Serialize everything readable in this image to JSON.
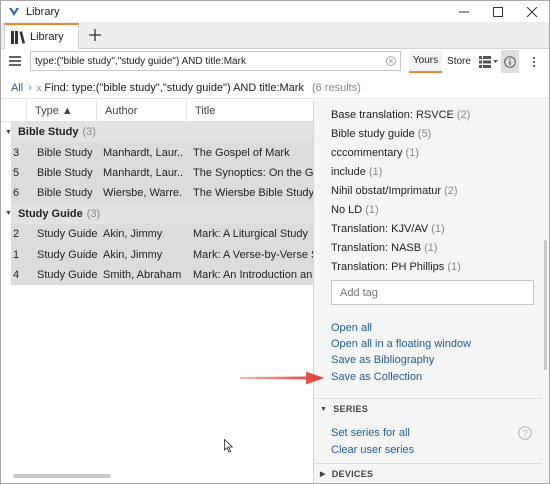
{
  "window": {
    "title": "Library"
  },
  "tab": {
    "label": "Library",
    "add_label": "+"
  },
  "search": {
    "value": "type:(\"bible study\",\"study guide\") AND title:Mark"
  },
  "toolbar": {
    "yours": "Yours",
    "store": "Store"
  },
  "breadcrumb": {
    "all": "All",
    "separator": "›",
    "close": "x",
    "find": "Find: type:(\"bible study\",\"study guide\") AND title:Mark",
    "count": "(6 results)"
  },
  "table": {
    "columns": {
      "type": "Type ▲",
      "author": "Author",
      "title": "Title"
    },
    "groups": [
      {
        "name": "Bible Study",
        "count": "(3)",
        "rows": [
          {
            "num": "3",
            "type": "Bible Study",
            "author": "Manhardt, Laur...",
            "title": "The Gospel of Mark"
          },
          {
            "num": "5",
            "type": "Bible Study",
            "author": "Manhardt, Laur...",
            "title": "The Synoptics: On the Go"
          },
          {
            "num": "6",
            "type": "Bible Study",
            "author": "Wiersbe, Warre...",
            "title": "The Wiersbe Bible Study"
          }
        ]
      },
      {
        "name": "Study Guide",
        "count": "(3)",
        "rows": [
          {
            "num": "2",
            "type": "Study Guide",
            "author": "Akin, Jimmy",
            "title": "Mark: A Liturgical Study"
          },
          {
            "num": "1",
            "type": "Study Guide",
            "author": "Akin, Jimmy",
            "title": "Mark: A Verse-by-Verse S"
          },
          {
            "num": "4",
            "type": "Study Guide",
            "author": "Smith, Abraham",
            "title": "Mark: An Introduction an"
          }
        ]
      }
    ]
  },
  "sidebar": {
    "tags": [
      {
        "label": "Base translation: RSVCE",
        "count": "(2)"
      },
      {
        "label": "Bible study guide",
        "count": "(5)"
      },
      {
        "label": "cccommentary",
        "count": "(1)"
      },
      {
        "label": "include",
        "count": "(1)"
      },
      {
        "label": "Nihil obstat/Imprimatur",
        "count": "(2)"
      },
      {
        "label": "No LD",
        "count": "(1)"
      },
      {
        "label": "Translation: KJV/AV",
        "count": "(1)"
      },
      {
        "label": "Translation: NASB",
        "count": "(1)"
      },
      {
        "label": "Translation: PH Phillips",
        "count": "(1)"
      }
    ],
    "add_tag_placeholder": "Add tag",
    "actions": [
      "Open all",
      "Open all in a floating window",
      "Save as Bibliography",
      "Save as Collection"
    ],
    "series": {
      "header": "SERIES",
      "actions": [
        "Set series for all",
        "Clear user series"
      ]
    },
    "devices": {
      "header": "DEVICES"
    }
  },
  "colors": {
    "accent": "#e8892a",
    "link": "#1f5fa0",
    "annotation_arrow": "#e03a30"
  },
  "icons": {
    "app": "logos-app-icon",
    "library": "books-icon",
    "menu": "hamburger-icon",
    "clear": "clear-icon",
    "layout": "grid-layout-icon",
    "info": "info-icon",
    "more": "more-icon",
    "help": "help-icon"
  }
}
